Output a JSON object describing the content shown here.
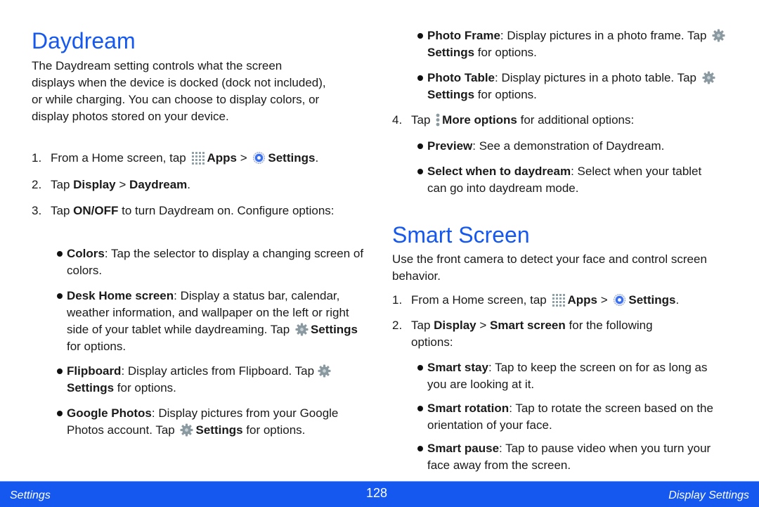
{
  "daydream": {
    "title": "Daydream",
    "intro": "The Daydream setting controls what the screen displays when the device is docked (dock not included), or while charging. You can choose to display colors, or display photos stored on your device.",
    "step1": {
      "num": "1.",
      "pre": "From a Home screen, tap",
      "apps": "Apps",
      "sep": ">",
      "settings": "Settings",
      "post": "."
    },
    "step2": {
      "num": "2.",
      "pre": "Tap",
      "display": "Display",
      "sep": ">",
      "target": "Daydream",
      "post": "."
    },
    "step3": {
      "num": "3.",
      "pre": "Tap",
      "toggle": "ON/OFF",
      "post": "to turn Daydream on. Configure options:"
    },
    "options": [
      {
        "name": "Colors",
        "text": ": Tap the selector to display a changing screen of colors."
      },
      {
        "name": "Desk Home screen",
        "text": ": Display a status bar, calendar, weather information, and wallpaper on the left or right side of your tablet while daydreaming. Tap",
        "settings": "Settings",
        "post": "for options."
      },
      {
        "name": "Flipboard",
        "text": ": Display articles from Flipboard. Tap",
        "settings": "Settings",
        "post": "for options."
      },
      {
        "name": "Google Photos",
        "text": ": Display pictures from your Google Photos account. Tap",
        "settings": "Settings",
        "post": "for options."
      },
      {
        "name": "Photo Frame",
        "text": ": Display pictures in a photo frame. Tap",
        "settings": "Settings",
        "post": "for options."
      },
      {
        "name": "Photo Table",
        "text": ": Display pictures in a photo table. Tap",
        "settings": "Settings",
        "post": "for options."
      }
    ],
    "step4": {
      "num": "4.",
      "pre": "Tap",
      "more": "More options",
      "post": "for additional options:"
    },
    "more_options": [
      {
        "name": "Preview",
        "text": ": See a demonstration of Daydream."
      },
      {
        "name": "Select when to daydream",
        "text": ": Select when your tablet can go into daydream mode."
      }
    ]
  },
  "smart_screen": {
    "title": "Smart Screen",
    "intro": "Use the front camera to detect your face and control screen behavior.",
    "step1": {
      "num": "1.",
      "pre": "From a Home screen, tap",
      "apps": "Apps",
      "sep": ">",
      "settings": "Settings",
      "post": "."
    },
    "step2": {
      "num": "2.",
      "pre": "Tap",
      "display": "Display",
      "sep": ">",
      "target": "Smart screen",
      "post": "for the following options:"
    },
    "options": [
      {
        "name": "Smart stay",
        "text": ": Tap to keep the screen on for as long as you are looking at it."
      },
      {
        "name": "Smart rotation",
        "text": ": Tap to rotate the screen based on the orientation of your face."
      },
      {
        "name": "Smart pause",
        "text": ": Tap to pause video when you turn your face away from the screen."
      }
    ]
  },
  "footer": {
    "left": "Settings",
    "page": "128",
    "right": "Display Settings",
    "color": "#1558f0"
  },
  "colors": {
    "heading": "#1558f0",
    "gear_grey": "#8a9aa0",
    "settings_blue": "#3a6ff0"
  }
}
